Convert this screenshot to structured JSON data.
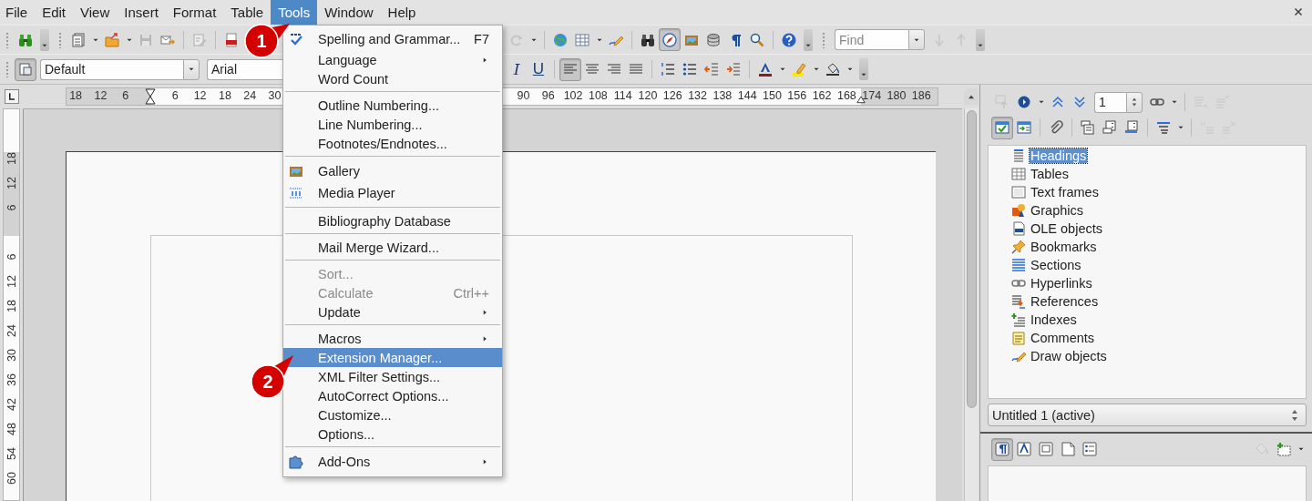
{
  "menubar": [
    {
      "label": "File",
      "selected": false
    },
    {
      "label": "Edit",
      "selected": false
    },
    {
      "label": "View",
      "selected": false
    },
    {
      "label": "Insert",
      "selected": false
    },
    {
      "label": "Format",
      "selected": false
    },
    {
      "label": "Table",
      "selected": false
    },
    {
      "label": "Tools",
      "selected": true
    },
    {
      "label": "Window",
      "selected": false
    },
    {
      "label": "Help",
      "selected": false
    }
  ],
  "standard_toolbar": {
    "left": [
      {
        "kind": "grip"
      },
      {
        "kind": "button",
        "disabled": false,
        "pressed": false
      },
      {
        "kind": "overflow"
      },
      {
        "kind": "grip"
      },
      {
        "kind": "button",
        "disabled": false,
        "pressed": false
      },
      {
        "kind": "caret"
      },
      {
        "kind": "button",
        "disabled": false,
        "pressed": false
      },
      {
        "kind": "caret"
      },
      {
        "kind": "button",
        "disabled": true,
        "pressed": false
      },
      {
        "kind": "button",
        "disabled": false,
        "pressed": false
      },
      {
        "kind": "separator"
      },
      {
        "kind": "button",
        "disabled": true,
        "pressed": false
      },
      {
        "kind": "separator"
      },
      {
        "kind": "button",
        "disabled": false,
        "pressed": false
      }
    ],
    "right": [
      {
        "kind": "button",
        "disabled": true,
        "pressed": false
      },
      {
        "kind": "caret"
      },
      {
        "kind": "separator"
      },
      {
        "kind": "button",
        "disabled": false,
        "pressed": false
      },
      {
        "kind": "button",
        "disabled": false,
        "pressed": false
      },
      {
        "kind": "caret"
      },
      {
        "kind": "button",
        "disabled": false,
        "pressed": false
      },
      {
        "kind": "separator"
      },
      {
        "kind": "button",
        "disabled": false,
        "pressed": false
      },
      {
        "kind": "button",
        "disabled": false,
        "pressed": true
      },
      {
        "kind": "button",
        "disabled": false,
        "pressed": false
      },
      {
        "kind": "button",
        "disabled": false,
        "pressed": false
      },
      {
        "kind": "button",
        "disabled": false,
        "pressed": false
      },
      {
        "kind": "button",
        "disabled": false,
        "pressed": false
      },
      {
        "kind": "separator"
      },
      {
        "kind": "button",
        "disabled": false,
        "pressed": false
      },
      {
        "kind": "overflow"
      },
      {
        "kind": "grip"
      },
      {
        "kind": "find",
        "placeholder": "Find"
      },
      {
        "kind": "button",
        "disabled": true,
        "pressed": false
      },
      {
        "kind": "button",
        "disabled": true,
        "pressed": false
      },
      {
        "kind": "overflow"
      }
    ]
  },
  "formatting_toolbar": {
    "left": [
      {
        "kind": "grip"
      },
      {
        "kind": "button",
        "disabled": false,
        "pressed": true
      },
      {
        "kind": "combo",
        "value": "Default"
      },
      {
        "kind": "combo",
        "value": "Arial"
      }
    ],
    "right": [
      {
        "kind": "italic",
        "label": "I",
        "disabled": false,
        "pressed": false
      },
      {
        "kind": "underline",
        "label": "U",
        "disabled": false,
        "pressed": false
      },
      {
        "kind": "separator"
      },
      {
        "kind": "button",
        "disabled": false,
        "pressed": true
      },
      {
        "kind": "button",
        "disabled": false,
        "pressed": false
      },
      {
        "kind": "button",
        "disabled": false,
        "pressed": false
      },
      {
        "kind": "button",
        "disabled": false,
        "pressed": false
      },
      {
        "kind": "separator"
      },
      {
        "kind": "button",
        "disabled": false,
        "pressed": false
      },
      {
        "kind": "button",
        "disabled": false,
        "pressed": false
      },
      {
        "kind": "button",
        "disabled": false,
        "pressed": false
      },
      {
        "kind": "button",
        "disabled": false,
        "pressed": false
      },
      {
        "kind": "separator"
      },
      {
        "kind": "button",
        "disabled": false,
        "pressed": false
      },
      {
        "kind": "caret"
      },
      {
        "kind": "button",
        "disabled": false,
        "pressed": false
      },
      {
        "kind": "caret"
      },
      {
        "kind": "button",
        "disabled": false,
        "pressed": false
      },
      {
        "kind": "caret"
      },
      {
        "kind": "overflow"
      }
    ]
  },
  "horizontal_ruler": {
    "left_margin_numbers": [
      "18",
      "12",
      "6"
    ],
    "numbers": [
      "6",
      "12",
      "18",
      "24",
      "30"
    ],
    "right_numbers": [
      "90",
      "96",
      "102",
      "108",
      "114",
      "120",
      "126",
      "132",
      "138",
      "144",
      "150",
      "156",
      "162",
      "168",
      "174",
      "180",
      "186"
    ]
  },
  "vertical_ruler": {
    "top_margin_numbers": [
      "18",
      "12",
      "6"
    ],
    "numbers": [
      "6",
      "12",
      "18",
      "24",
      "30",
      "36",
      "42",
      "48",
      "54",
      "60"
    ]
  },
  "navigator": {
    "toolbar_rows": [
      [
        {
          "kind": "button",
          "disabled": true,
          "pressed": false
        },
        {
          "kind": "button",
          "disabled": false,
          "pressed": false
        },
        {
          "kind": "caret"
        },
        {
          "kind": "button",
          "disabled": false,
          "pressed": false
        },
        {
          "kind": "button",
          "disabled": false,
          "pressed": false
        },
        {
          "kind": "spin",
          "value": "1"
        },
        {
          "kind": "button",
          "disabled": false,
          "pressed": false
        },
        {
          "kind": "caret"
        },
        {
          "kind": "separator"
        },
        {
          "kind": "button",
          "disabled": true,
          "pressed": false
        },
        {
          "kind": "button",
          "disabled": true,
          "pressed": false
        }
      ],
      [
        {
          "kind": "button",
          "disabled": false,
          "pressed": true
        },
        {
          "kind": "button",
          "disabled": false,
          "pressed": false
        },
        {
          "kind": "separator"
        },
        {
          "kind": "button",
          "disabled": false,
          "pressed": false
        },
        {
          "kind": "separator"
        },
        {
          "kind": "button",
          "disabled": false,
          "pressed": false
        },
        {
          "kind": "button",
          "disabled": false,
          "pressed": false
        },
        {
          "kind": "button",
          "disabled": false,
          "pressed": false
        },
        {
          "kind": "separator"
        },
        {
          "kind": "button",
          "disabled": false,
          "pressed": false
        },
        {
          "kind": "caret"
        },
        {
          "kind": "separator"
        },
        {
          "kind": "button",
          "disabled": true,
          "pressed": false
        },
        {
          "kind": "button",
          "disabled": true,
          "pressed": false
        }
      ]
    ],
    "items": [
      {
        "label": "Headings",
        "selected": true
      },
      {
        "label": "Tables",
        "selected": false
      },
      {
        "label": "Text frames",
        "selected": false
      },
      {
        "label": "Graphics",
        "selected": false
      },
      {
        "label": "OLE objects",
        "selected": false
      },
      {
        "label": "Bookmarks",
        "selected": false
      },
      {
        "label": "Sections",
        "selected": false
      },
      {
        "label": "Hyperlinks",
        "selected": false
      },
      {
        "label": "References",
        "selected": false
      },
      {
        "label": "Indexes",
        "selected": false
      },
      {
        "label": "Comments",
        "selected": false
      },
      {
        "label": "Draw objects",
        "selected": false
      }
    ],
    "document": "Untitled 1 (active)"
  },
  "styles_panel": {
    "toolbar": [
      {
        "kind": "button",
        "disabled": false,
        "pressed": true
      },
      {
        "kind": "button",
        "disabled": false,
        "pressed": false
      },
      {
        "kind": "button",
        "disabled": false,
        "pressed": false
      },
      {
        "kind": "button",
        "disabled": false,
        "pressed": false
      },
      {
        "kind": "button",
        "disabled": false,
        "pressed": false
      },
      {
        "kind": "button",
        "disabled": true,
        "pressed": false
      },
      {
        "kind": "button",
        "disabled": false,
        "pressed": false
      },
      {
        "kind": "caret"
      }
    ]
  },
  "tools_menu": {
    "items": [
      {
        "kind": "item",
        "label": "Spelling and Grammar...",
        "shortcut": "F7",
        "submenu": false,
        "disabled": false,
        "selected": false
      },
      {
        "kind": "item",
        "label": "Language",
        "submenu": true,
        "disabled": false,
        "selected": false
      },
      {
        "kind": "item",
        "label": "Word Count",
        "submenu": false,
        "disabled": false,
        "selected": false
      },
      {
        "kind": "separator"
      },
      {
        "kind": "item",
        "label": "Outline Numbering...",
        "submenu": false,
        "disabled": false,
        "selected": false
      },
      {
        "kind": "item",
        "label": "Line Numbering...",
        "submenu": false,
        "disabled": false,
        "selected": false
      },
      {
        "kind": "item",
        "label": "Footnotes/Endnotes...",
        "submenu": false,
        "disabled": false,
        "selected": false
      },
      {
        "kind": "separator"
      },
      {
        "kind": "item",
        "label": "Gallery",
        "submenu": false,
        "disabled": false,
        "selected": false
      },
      {
        "kind": "item",
        "label": "Media Player",
        "submenu": false,
        "disabled": false,
        "selected": false
      },
      {
        "kind": "separator"
      },
      {
        "kind": "item",
        "label": "Bibliography Database",
        "submenu": false,
        "disabled": false,
        "selected": false
      },
      {
        "kind": "separator"
      },
      {
        "kind": "item",
        "label": "Mail Merge Wizard...",
        "submenu": false,
        "disabled": false,
        "selected": false
      },
      {
        "kind": "separator"
      },
      {
        "kind": "item",
        "label": "Sort...",
        "submenu": false,
        "disabled": true,
        "selected": false
      },
      {
        "kind": "item",
        "label": "Calculate",
        "shortcut": "Ctrl++",
        "submenu": false,
        "disabled": true,
        "selected": false
      },
      {
        "kind": "item",
        "label": "Update",
        "submenu": true,
        "disabled": false,
        "selected": false
      },
      {
        "kind": "separator"
      },
      {
        "kind": "item",
        "label": "Macros",
        "submenu": true,
        "disabled": false,
        "selected": false
      },
      {
        "kind": "item",
        "label": "Extension Manager...",
        "submenu": false,
        "disabled": false,
        "selected": true
      },
      {
        "kind": "item",
        "label": "XML Filter Settings...",
        "submenu": false,
        "disabled": false,
        "selected": false
      },
      {
        "kind": "item",
        "label": "AutoCorrect Options...",
        "submenu": false,
        "disabled": false,
        "selected": false
      },
      {
        "kind": "item",
        "label": "Customize...",
        "submenu": false,
        "disabled": false,
        "selected": false
      },
      {
        "kind": "item",
        "label": "Options...",
        "submenu": false,
        "disabled": false,
        "selected": false
      },
      {
        "kind": "separator"
      },
      {
        "kind": "item",
        "label": "Add-Ons",
        "submenu": true,
        "disabled": false,
        "selected": false
      }
    ]
  },
  "callouts": [
    {
      "label": "1"
    },
    {
      "label": "2"
    }
  ]
}
